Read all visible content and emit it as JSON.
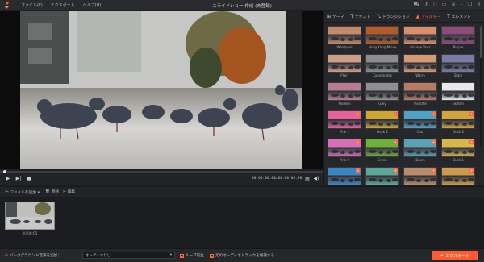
{
  "title_bar": {
    "menus": [
      "ファイル(F)",
      "エクスポート",
      "ヘルプ(H)"
    ],
    "title": "スライドショー 作成 (未登録)",
    "window_icons": [
      "cart-icon",
      "key-icon",
      "user-icon",
      "feedback-icon",
      "menu-icon",
      "minimize-icon",
      "restore-icon",
      "close-icon"
    ]
  },
  "player": {
    "timecode": "00:00:00.00/00:00:05.00",
    "progress": 0.01
  },
  "panel": {
    "tabs": [
      {
        "label": "テーマ",
        "icon": "grid-icon",
        "active": false
      },
      {
        "label": "テキスト",
        "icon": "text-icon",
        "active": false
      },
      {
        "label": "トランジション",
        "icon": "transition-icon",
        "active": false
      },
      {
        "label": "フィルター",
        "icon": "filter-icon",
        "active": true
      },
      {
        "label": "エレメント",
        "icon": "element-icon",
        "active": false
      }
    ],
    "filters": [
      {
        "name": "Whirlpool",
        "tint": "#c48a6b",
        "badge": false
      },
      {
        "name": "Hong Kong Movie",
        "tint": "#b65a2c",
        "badge": false
      },
      {
        "name": "Orange Dots",
        "tint": "#d98f6a",
        "badge": false
      },
      {
        "name": "Purple",
        "tint": "#8d4b77",
        "badge": false
      },
      {
        "name": "Plain",
        "tint": "#cf9e86",
        "badge": false
      },
      {
        "name": "Coordinates",
        "tint": "#8d8d8d",
        "badge": false
      },
      {
        "name": "Warm",
        "tint": "#d49a73",
        "badge": false
      },
      {
        "name": "Stars",
        "tint": "#7a7aa6",
        "badge": false
      },
      {
        "name": "Modern",
        "tint": "#b77d8f",
        "badge": false
      },
      {
        "name": "Grey",
        "tint": "#8f8f8f",
        "badge": false
      },
      {
        "name": "Pixelate",
        "tint": "#b57c62",
        "badge": false
      },
      {
        "name": "Sketch",
        "tint": "#e9e9e9",
        "badge": false
      },
      {
        "name": "Pink 1",
        "tint": "#e6609a",
        "badge": true
      },
      {
        "name": "Dusk 2",
        "tint": "#d0a52c",
        "badge": true
      },
      {
        "name": "Cool",
        "tint": "#4fa1c9",
        "badge": true
      },
      {
        "name": "Dusk 3",
        "tint": "#d4a43a",
        "badge": true
      },
      {
        "name": "Pink 2",
        "tint": "#d76fb6",
        "badge": true
      },
      {
        "name": "Green",
        "tint": "#6fb03b",
        "badge": true
      },
      {
        "name": "Dawn",
        "tint": "#5aa3b5",
        "badge": true
      },
      {
        "name": "Dusk 1",
        "tint": "#d6b74a",
        "badge": true
      },
      {
        "name": "",
        "tint": "#3a86c3",
        "badge": true
      },
      {
        "name": "",
        "tint": "#5ba89a",
        "badge": true
      },
      {
        "name": "",
        "tint": "#b88c6a",
        "badge": true
      },
      {
        "name": "",
        "tint": "#cc9b4a",
        "badge": true
      }
    ]
  },
  "media_bar": {
    "add_file": "ファイルを追加",
    "delete": "削除",
    "edit": "編集"
  },
  "storyboard": {
    "clip_time": "00:00:05"
  },
  "bottom_bar": {
    "bgm_label": "バックグラウンド音楽を追加：",
    "audio_select": "オーディオなし",
    "loop_label": "ループ再生",
    "keep_original_label": "元のオーディオトラックを保持する",
    "export_label": "エクスポート"
  },
  "colors": {
    "accent": "#ff5b2e",
    "background": "#1e1f22"
  }
}
